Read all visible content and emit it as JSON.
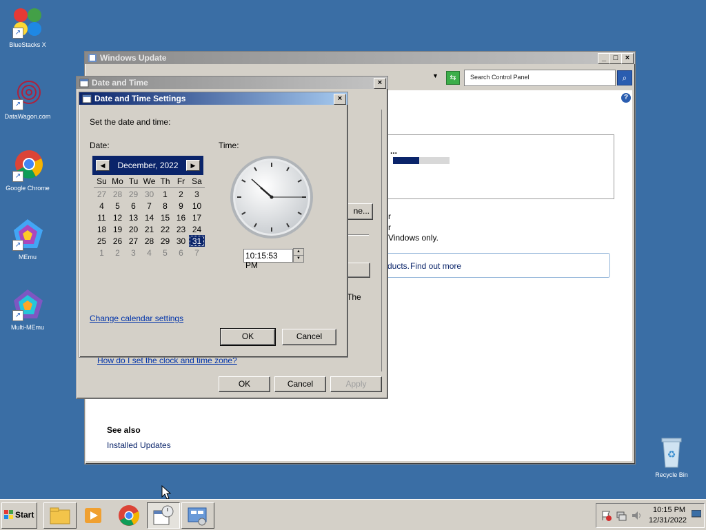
{
  "desktop": {
    "icons": [
      {
        "label": "BlueStacks X"
      },
      {
        "label": "DataWagon.com"
      },
      {
        "label": "Google Chrome"
      },
      {
        "label": "MEmu"
      },
      {
        "label": "Multi-MEmu"
      },
      {
        "label": "Recycle Bin"
      }
    ]
  },
  "windows_update": {
    "title": "Windows Update",
    "search_placeholder": "Search Control Panel",
    "partial_text": [
      "r",
      "r",
      "Vindows only."
    ],
    "partial_button": "ne...",
    "partial_products": "ducts.",
    "find_out_more": "Find out more",
    "partial_the": "The",
    "see_also": "See also",
    "installed_updates": "Installed Updates"
  },
  "date_time": {
    "title": "Date and Time",
    "help_link": "How do I set the clock and time zone?",
    "ok": "OK",
    "cancel": "Cancel",
    "apply": "Apply"
  },
  "settings": {
    "title": "Date and Time Settings",
    "instruction": "Set the date and time:",
    "date_label": "Date:",
    "time_label": "Time:",
    "month_label": "December, 2022",
    "weekdays": [
      "Su",
      "Mo",
      "Tu",
      "We",
      "Th",
      "Fr",
      "Sa"
    ],
    "weeks": [
      [
        "27",
        "28",
        "29",
        "30",
        "1",
        "2",
        "3"
      ],
      [
        "4",
        "5",
        "6",
        "7",
        "8",
        "9",
        "10"
      ],
      [
        "11",
        "12",
        "13",
        "14",
        "15",
        "16",
        "17"
      ],
      [
        "18",
        "19",
        "20",
        "21",
        "22",
        "23",
        "24"
      ],
      [
        "25",
        "26",
        "27",
        "28",
        "29",
        "30",
        "31"
      ],
      [
        "1",
        "2",
        "3",
        "4",
        "5",
        "6",
        "7"
      ]
    ],
    "time_value": "10:15:53 PM",
    "change_calendar": "Change calendar settings",
    "ok": "OK",
    "cancel": "Cancel"
  },
  "taskbar": {
    "start": "Start",
    "clock_time": "10:15 PM",
    "clock_date": "12/31/2022"
  }
}
